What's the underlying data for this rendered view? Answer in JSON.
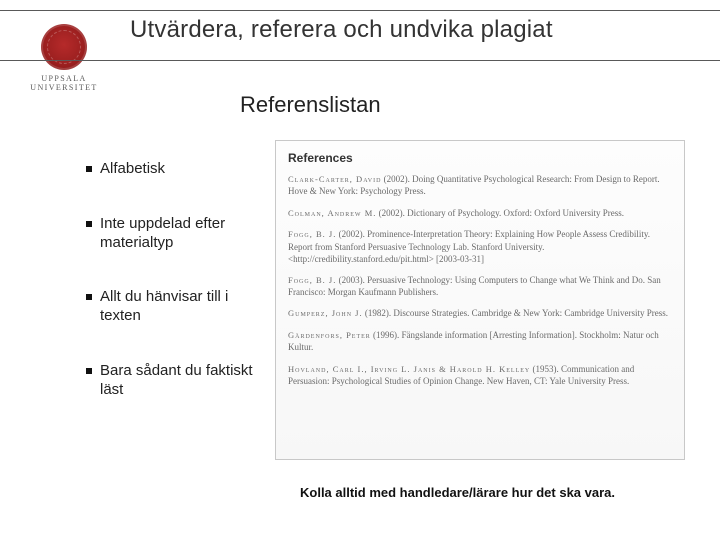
{
  "university": {
    "line1": "UPPSALA",
    "line2": "UNIVERSITET"
  },
  "header": {
    "title": "Utvärdera, referera och undvika plagiat"
  },
  "subheading": "Referenslistan",
  "bullets": {
    "b1": "Alfabetisk",
    "b2": "Inte uppdelad efter materialtyp",
    "b3": "Allt du hänvisar till i texten",
    "b4": "Bara sådant du faktiskt läst"
  },
  "references": {
    "heading": "References",
    "items": [
      {
        "author": "Clark-Carter, David",
        "rest": " (2002). Doing Quantitative Psychological Research: From Design to Report. Hove & New York: Psychology Press."
      },
      {
        "author": "Colman, Andrew M.",
        "rest": " (2002). Dictionary of Psychology. Oxford: Oxford University Press."
      },
      {
        "author": "Fogg, B. J.",
        "rest": " (2002). Prominence-Interpretation Theory: Explaining How People Assess Credibility. Report from Stanford Persuasive Technology Lab. Stanford University. <http://credibility.stanford.edu/pit.html> [2003-03-31]"
      },
      {
        "author": "Fogg, B. J.",
        "rest": " (2003). Persuasive Technology: Using Computers to Change what We Think and Do. San Francisco: Morgan Kaufmann Publishers."
      },
      {
        "author": "Gumperz, John J.",
        "rest": " (1982). Discourse Strategies. Cambridge & New York: Cambridge University Press."
      },
      {
        "author": "Gärdenfors, Peter",
        "rest": " (1996). Fängslande information [Arresting Information]. Stockholm: Natur och Kultur."
      },
      {
        "author": "Hovland, Carl I., Irving L. Janis & Harold H. Kelley",
        "rest": " (1953). Communication and Persuasion: Psychological Studies of Opinion Change. New Haven, CT: Yale University Press."
      }
    ]
  },
  "footer": {
    "note": "Kolla alltid med handledare/lärare hur det ska vara."
  }
}
